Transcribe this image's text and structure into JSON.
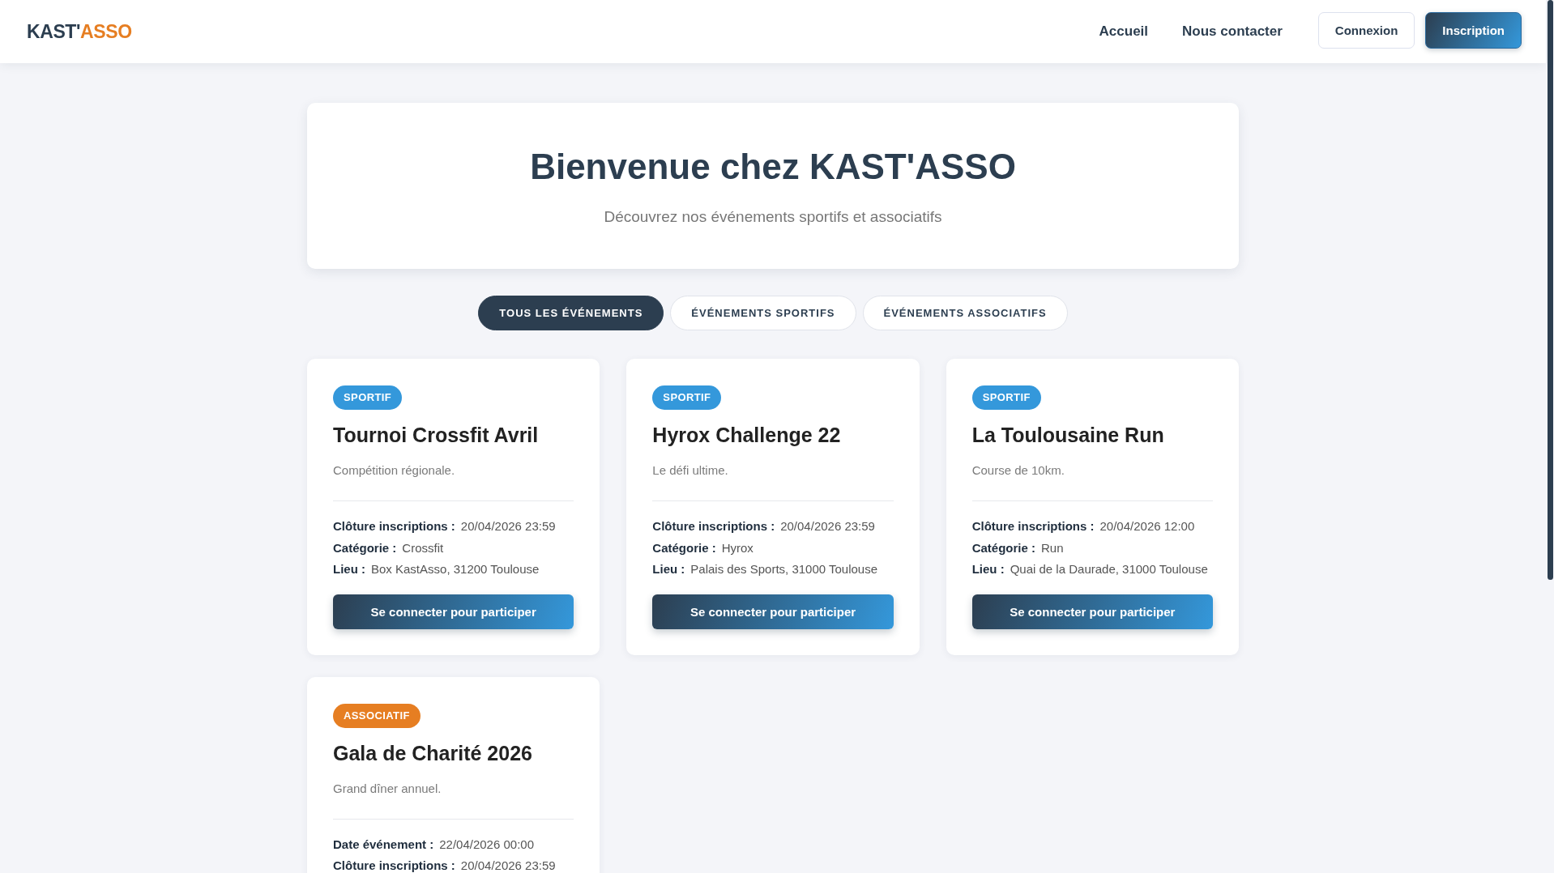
{
  "header": {
    "logo": {
      "text": "KAST'",
      "accent": "ASSO"
    },
    "nav": [
      "Accueil",
      "Nous contacter"
    ],
    "actions": [
      {
        "label": "Connexion",
        "kind": "outline"
      },
      {
        "label": "Inscription",
        "kind": "primary"
      }
    ]
  },
  "hero": {
    "title": "Bienvenue chez KAST'ASSO",
    "subtitle": "Découvrez nos événements sportifs et associatifs"
  },
  "tabs": [
    {
      "label": "TOUS LES ÉVÉNEMENTS",
      "selected": true
    },
    {
      "label": "ÉVÉNEMENTS SPORTIFS",
      "selected": false
    },
    {
      "label": "ÉVÉNEMENTS ASSOCIATIFS",
      "selected": false
    }
  ],
  "events": [
    {
      "badge": "SPORTIF",
      "color": "#3498db",
      "title": "Tournoi Crossfit Avril",
      "description": "Compétition régionale.",
      "details": [
        {
          "label": "Clôture inscriptions :",
          "value": "20/04/2026 23:59"
        },
        {
          "label": "Catégorie :",
          "value": "Crossfit"
        },
        {
          "label": "Lieu :",
          "value": "Box KastAsso, 31200 Toulouse"
        }
      ],
      "button": "Se connecter pour participer"
    },
    {
      "badge": "SPORTIF",
      "color": "#3498db",
      "title": "Hyrox Challenge 22",
      "description": "Le défi ultime.",
      "details": [
        {
          "label": "Clôture inscriptions :",
          "value": "20/04/2026 23:59"
        },
        {
          "label": "Catégorie :",
          "value": "Hyrox"
        },
        {
          "label": "Lieu :",
          "value": "Palais des Sports, 31000 Toulouse"
        }
      ],
      "button": "Se connecter pour participer"
    },
    {
      "badge": "SPORTIF",
      "color": "#3498db",
      "title": "La Toulousaine Run",
      "description": "Course de 10km.",
      "details": [
        {
          "label": "Clôture inscriptions :",
          "value": "20/04/2026 12:00"
        },
        {
          "label": "Catégorie :",
          "value": "Run"
        },
        {
          "label": "Lieu :",
          "value": "Quai de la Daurade, 31000 Toulouse"
        }
      ],
      "button": "Se connecter pour participer"
    },
    {
      "badge": "ASSOCIATIF",
      "color": "#e67e22",
      "title": "Gala de Charité 2026",
      "description": "Grand dîner annuel.",
      "details": [
        {
          "label": "Date événement :",
          "value": "22/04/2026 00:00"
        },
        {
          "label": "Clôture inscriptions :",
          "value": "20/04/2026 23:59"
        }
      ]
    }
  ]
}
